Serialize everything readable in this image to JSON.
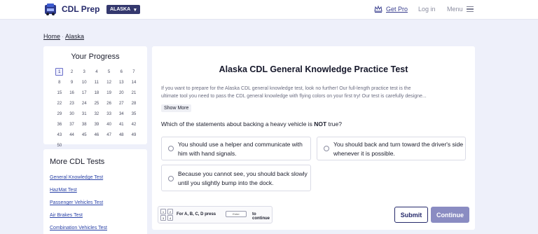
{
  "header": {
    "brand": "CDL Prep",
    "state_select": "ALASKA",
    "get_pro": "Get Pro",
    "login": "Log in",
    "menu": "Menu"
  },
  "breadcrumb": {
    "home": "Home",
    "separator": "·",
    "current": "Alaska"
  },
  "progress": {
    "title": "Your Progress",
    "current_question": "1",
    "questions": [
      "1",
      "2",
      "3",
      "4",
      "5",
      "6",
      "7",
      "8",
      "9",
      "10",
      "11",
      "12",
      "13",
      "14",
      "15",
      "16",
      "17",
      "18",
      "19",
      "20",
      "21",
      "22",
      "23",
      "24",
      "25",
      "26",
      "27",
      "28",
      "29",
      "30",
      "31",
      "32",
      "33",
      "34",
      "35",
      "36",
      "37",
      "38",
      "39",
      "40",
      "41",
      "42",
      "43",
      "44",
      "45",
      "46",
      "47",
      "48",
      "49",
      "50"
    ]
  },
  "more_tests": {
    "title": "More CDL Tests",
    "links": [
      "General Knowledge Test",
      "HazMat Test",
      "Passenger Vehicles Test",
      "Air Brakes Test",
      "Combination Vehicles Test"
    ]
  },
  "main": {
    "title": "Alaska CDL General Knowledge Practice Test",
    "intro_line1": "If you want to prepare for the Alaska CDL general knowledge test, look no further! Our full-length practice test is the",
    "intro_line2": "ultimate tool you need to pass the CDL general knowledge with flying colors on your first try! Our test is carefully designe...",
    "show_more": "Show More",
    "question_before": "Which of the statements about backing a heavy vehicle is ",
    "question_emphasis": "NOT",
    "question_after": " true?",
    "options": [
      "You should use a helper and communicate with him with hand signals.",
      "You should back and turn toward the driver's side whenever it is possible.",
      "Because you cannot see, you should back slowly until you slightly bump into the dock."
    ],
    "keyboard_hint": {
      "keys": [
        "1",
        "2",
        "3",
        "4"
      ],
      "text": "For A, B, C, D  press",
      "enter": "Enter",
      "tail": "to continue"
    },
    "submit": "Submit",
    "continue": "Continue"
  },
  "colors": {
    "brand_navy": "#262a6b",
    "page_bg": "#eef0fa",
    "link_blue": "#2c44a8",
    "continue_bg": "#8a8cc2"
  }
}
